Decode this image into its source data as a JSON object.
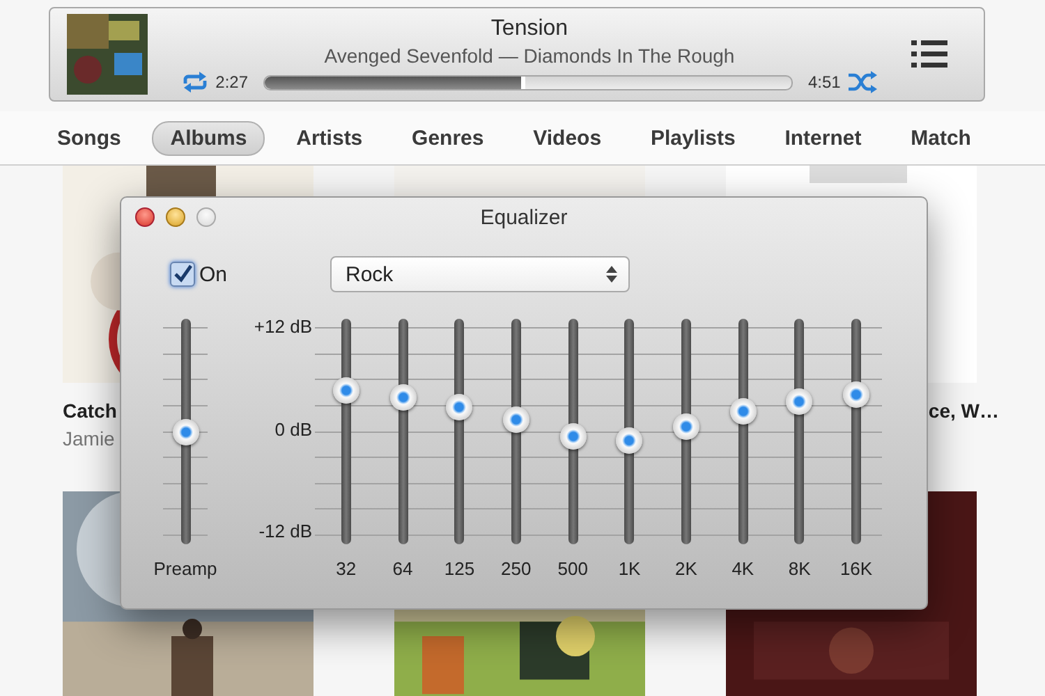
{
  "player": {
    "track_title": "Tension",
    "track_subtitle": "Avenged Sevenfold — Diamonds In The Rough",
    "elapsed": "2:27",
    "duration": "4:51",
    "level": 0.495
  },
  "tabs": [
    {
      "label": "Songs",
      "selected": false
    },
    {
      "label": "Albums",
      "selected": true
    },
    {
      "label": "Artists",
      "selected": false
    },
    {
      "label": "Genres",
      "selected": false
    },
    {
      "label": "Videos",
      "selected": false
    },
    {
      "label": "Playlists",
      "selected": false
    },
    {
      "label": "Internet",
      "selected": false
    },
    {
      "label": "Match",
      "selected": false
    }
  ],
  "albums": [
    {
      "kind": "picture",
      "caption_title": "Catch",
      "caption_artist": "Jamie"
    },
    {
      "kind": "picture"
    },
    {
      "kind": "picture",
      "caption_title": "ce, W…"
    },
    {
      "kind": "picture"
    },
    {
      "kind": "picture"
    },
    {
      "kind": "picture"
    }
  ],
  "equalizer": {
    "title": "Equalizer",
    "on": {
      "label": "On",
      "checked": true
    },
    "preset": "Rock",
    "preamp": {
      "label": "Preamp",
      "level": 0.5
    },
    "scale": [
      "+12 dB",
      "0 dB",
      "-12 dB"
    ],
    "bands": [
      {
        "label": "32",
        "level": 0.685
      },
      {
        "label": "64",
        "level": 0.654
      },
      {
        "label": "125",
        "level": 0.611
      },
      {
        "label": "250",
        "level": 0.556
      },
      {
        "label": "500",
        "level": 0.481
      },
      {
        "label": "1K",
        "level": 0.463
      },
      {
        "label": "2K",
        "level": 0.525
      },
      {
        "label": "4K",
        "level": 0.593
      },
      {
        "label": "8K",
        "level": 0.636
      },
      {
        "label": "16K",
        "level": 0.667
      }
    ]
  }
}
